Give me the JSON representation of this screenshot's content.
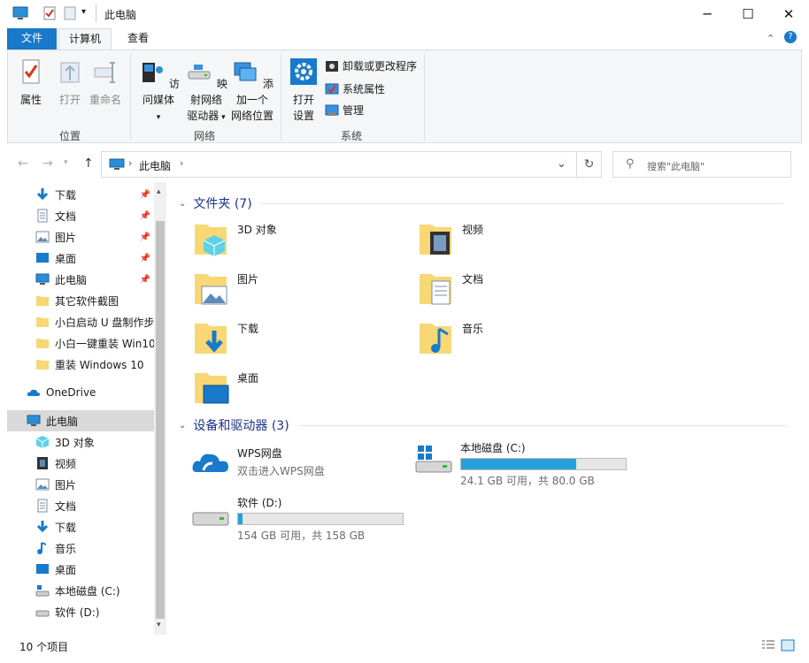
{
  "window": {
    "title": "此电脑"
  },
  "tabs": {
    "file": "文件",
    "computer": "计算机",
    "view": "查看"
  },
  "ribbon": {
    "properties": "属性",
    "open": "打开",
    "rename": "重命名",
    "access_media": "访问媒体",
    "map_drive_1": "映射网络",
    "map_drive_2": "驱动器",
    "add_location_1": "添加一个",
    "add_location_2": "网络位置",
    "open_settings_1": "打开",
    "open_settings_2": "设置",
    "uninstall": "卸载或更改程序",
    "sys_props": "系统属性",
    "manage": "管理",
    "group_location": "位置",
    "group_network": "网络",
    "group_system": "系统"
  },
  "address": {
    "crumb": "此电脑",
    "search_placeholder": "搜索\"此电脑\""
  },
  "sidebar": {
    "items": [
      "下载",
      "文档",
      "图片",
      "桌面",
      "此电脑",
      "其它软件截图",
      "小白启动 U 盘制作步",
      "小白一键重装 Win10",
      "重装 Windows 10",
      "OneDrive",
      "此电脑",
      "3D 对象",
      "视频",
      "图片",
      "文档",
      "下载",
      "音乐",
      "桌面",
      "本地磁盘 (C:)",
      "软件 (D:)"
    ]
  },
  "content": {
    "folders_header": "文件夹 (7)",
    "folders": [
      "3D 对象",
      "视频",
      "图片",
      "文档",
      "下载",
      "音乐",
      "桌面"
    ],
    "devices_header": "设备和驱动器 (3)",
    "wps": {
      "name": "WPS网盘",
      "sub": "双击进入WPS网盘"
    },
    "drive_c": {
      "name": "本地磁盘 (C:)",
      "info": "24.1 GB 可用，共 80.0 GB",
      "used_fraction": 0.7
    },
    "drive_d": {
      "name": "软件 (D:)",
      "info": "154 GB 可用，共 158 GB",
      "used_fraction": 0.025
    }
  },
  "status": {
    "count": "10 个项目"
  },
  "colors": {
    "accent": "#1979ca",
    "folder": "#f8d775",
    "bar": "#26a0da"
  }
}
